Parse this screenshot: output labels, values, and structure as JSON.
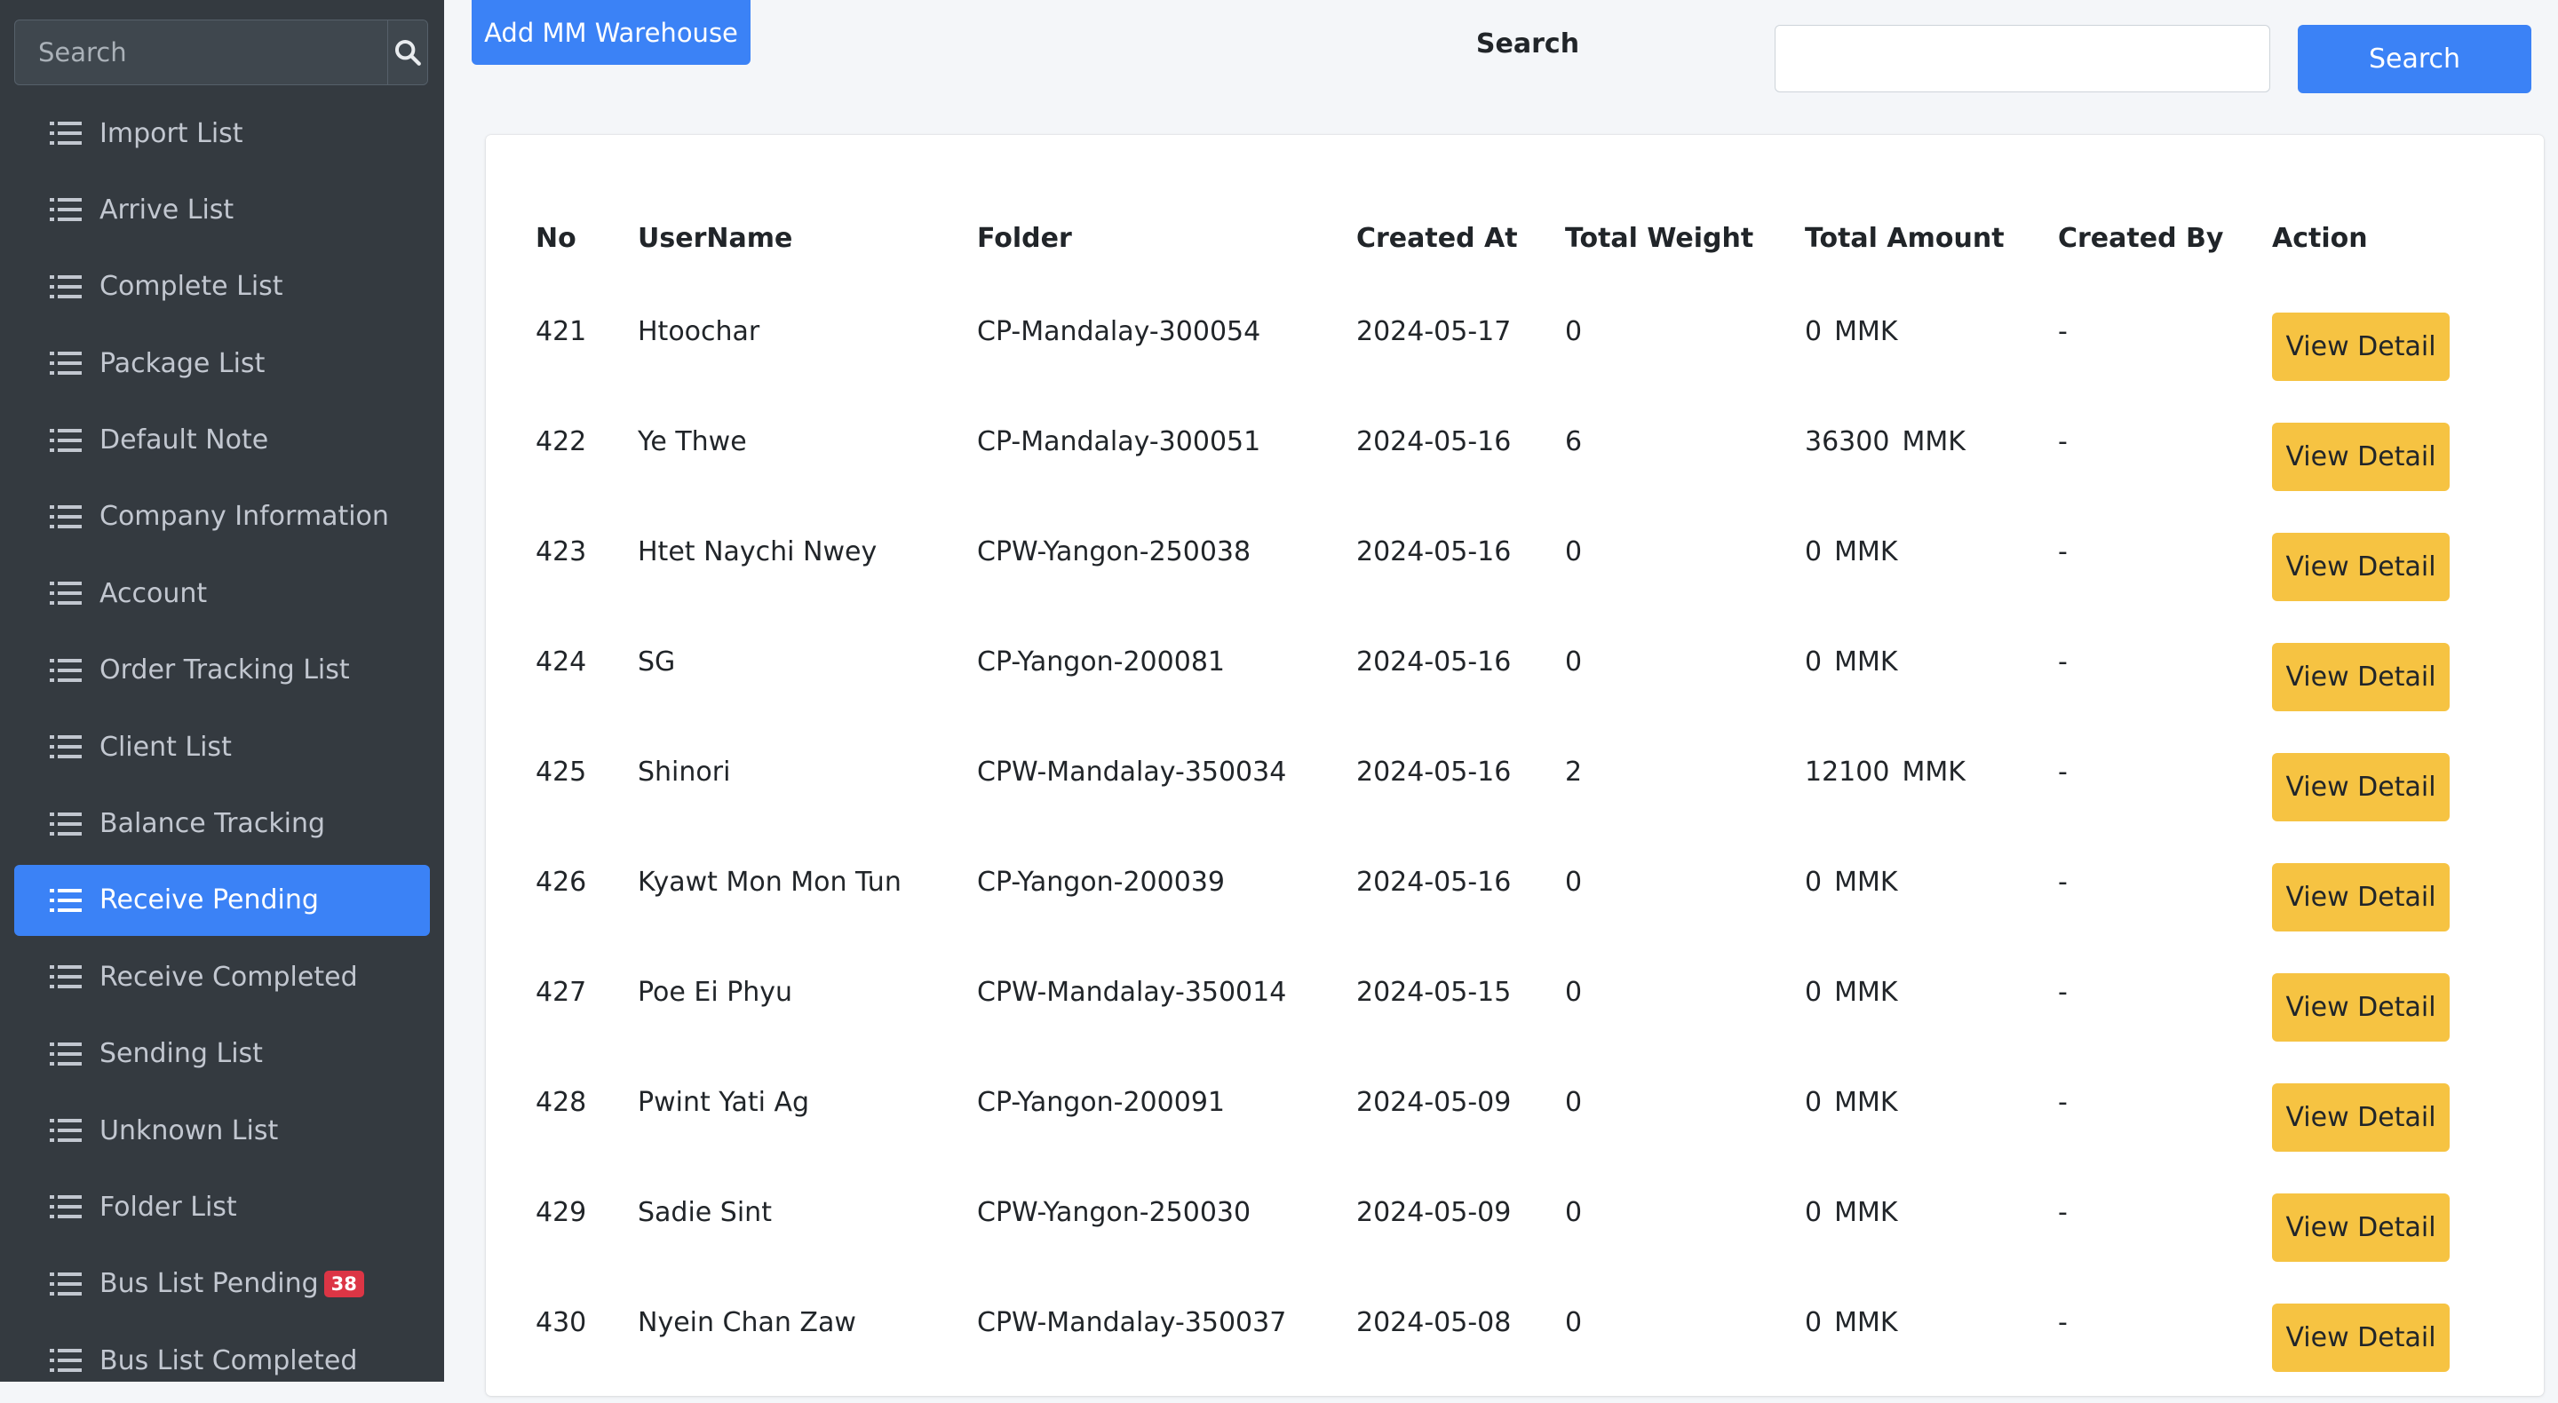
{
  "sidebar": {
    "search_placeholder": "Search",
    "items": [
      {
        "label": "Import List"
      },
      {
        "label": "Arrive List"
      },
      {
        "label": "Complete List"
      },
      {
        "label": "Package List"
      },
      {
        "label": "Default Note"
      },
      {
        "label": "Company Information"
      },
      {
        "label": "Account"
      },
      {
        "label": "Order Tracking List"
      },
      {
        "label": "Client List"
      },
      {
        "label": "Balance Tracking"
      },
      {
        "label": "Receive Pending",
        "active": true
      },
      {
        "label": "Receive Completed"
      },
      {
        "label": "Sending List"
      },
      {
        "label": "Unknown List"
      },
      {
        "label": "Folder List"
      },
      {
        "label": "Bus List Pending",
        "badge": "38"
      },
      {
        "label": "Bus List Completed"
      }
    ]
  },
  "topbar": {
    "add_button": "Add MM Warehouse",
    "search_label": "Search",
    "search_value": "",
    "search_button": "Search"
  },
  "table": {
    "headers": [
      "No",
      "UserName",
      "Folder",
      "Created At",
      "Total Weight",
      "Total Amount",
      "Created By",
      "Action"
    ],
    "action_label": "View Detail",
    "rows": [
      {
        "no": "421",
        "username": "Htoochar",
        "folder": "CP-Mandalay-300054",
        "created_at": "2024-05-17",
        "weight": "0",
        "amount": "0",
        "currency": "MMK",
        "created_by": "-"
      },
      {
        "no": "422",
        "username": "Ye Thwe",
        "folder": "CP-Mandalay-300051",
        "created_at": "2024-05-16",
        "weight": "6",
        "amount": "36300",
        "currency": "MMK",
        "created_by": "-"
      },
      {
        "no": "423",
        "username": "Htet Naychi Nwey",
        "folder": "CPW-Yangon-250038",
        "created_at": "2024-05-16",
        "weight": "0",
        "amount": "0",
        "currency": "MMK",
        "created_by": "-"
      },
      {
        "no": "424",
        "username": "SG",
        "folder": "CP-Yangon-200081",
        "created_at": "2024-05-16",
        "weight": "0",
        "amount": "0",
        "currency": "MMK",
        "created_by": "-"
      },
      {
        "no": "425",
        "username": "Shinori",
        "folder": "CPW-Mandalay-350034",
        "created_at": "2024-05-16",
        "weight": "2",
        "amount": "12100",
        "currency": "MMK",
        "created_by": "-"
      },
      {
        "no": "426",
        "username": "Kyawt Mon Mon Tun",
        "folder": "CP-Yangon-200039",
        "created_at": "2024-05-16",
        "weight": "0",
        "amount": "0",
        "currency": "MMK",
        "created_by": "-"
      },
      {
        "no": "427",
        "username": "Poe Ei Phyu",
        "folder": "CPW-Mandalay-350014",
        "created_at": "2024-05-15",
        "weight": "0",
        "amount": "0",
        "currency": "MMK",
        "created_by": "-"
      },
      {
        "no": "428",
        "username": "Pwint Yati Ag",
        "folder": "CP-Yangon-200091",
        "created_at": "2024-05-09",
        "weight": "0",
        "amount": "0",
        "currency": "MMK",
        "created_by": "-"
      },
      {
        "no": "429",
        "username": "Sadie Sint",
        "folder": "CPW-Yangon-250030",
        "created_at": "2024-05-09",
        "weight": "0",
        "amount": "0",
        "currency": "MMK",
        "created_by": "-"
      },
      {
        "no": "430",
        "username": "Nyein Chan Zaw",
        "folder": "CPW-Mandalay-350037",
        "created_at": "2024-05-08",
        "weight": "0",
        "amount": "0",
        "currency": "MMK",
        "created_by": "-"
      }
    ]
  },
  "colors": {
    "sidebar_bg": "#343a40",
    "accent": "#3b82f6",
    "action_button": "#f6c342",
    "badge": "#dc3545"
  }
}
